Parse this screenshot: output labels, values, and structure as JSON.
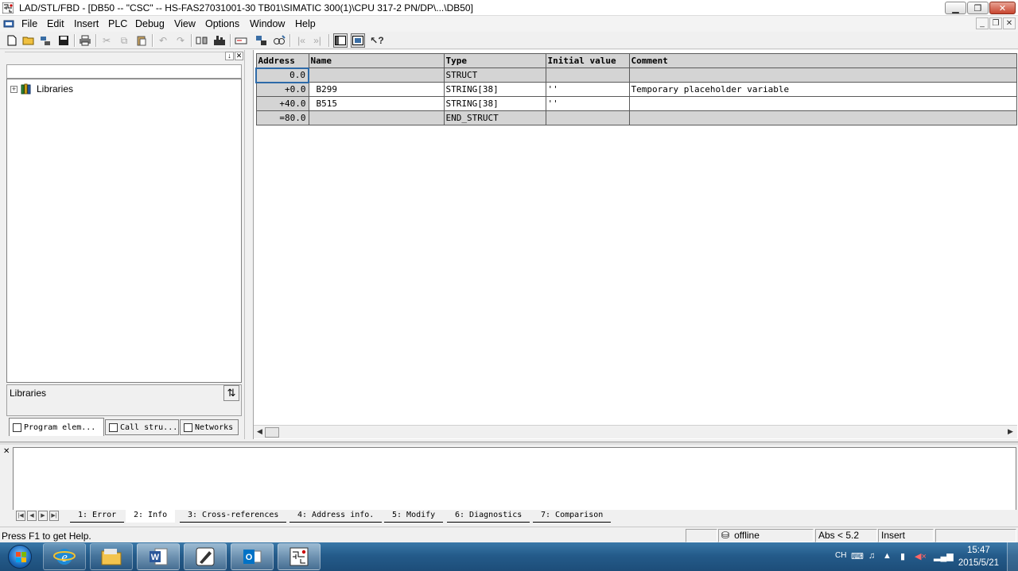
{
  "window": {
    "title": "LAD/STL/FBD  - [DB50 -- \"CSC\" -- HS-FAS27031001-30 TB01\\SIMATIC 300(1)\\CPU 317-2 PN/DP\\...\\DB50]",
    "icon": "lad-stl-fbd-app-icon"
  },
  "menu": {
    "items": [
      "File",
      "Edit",
      "Insert",
      "PLC",
      "Debug",
      "View",
      "Options",
      "Window",
      "Help"
    ]
  },
  "left_panel": {
    "tree_root": "Libraries",
    "description_label": "Libraries",
    "tabs": [
      "Program elem...",
      "Call stru...",
      "Networks"
    ]
  },
  "declaration_table": {
    "headers": [
      "Address",
      "Name",
      "Type",
      "Initial value",
      "Comment"
    ],
    "rows": [
      {
        "address": "0.0",
        "name": "",
        "type": "STRUCT",
        "initial": "",
        "comment": ""
      },
      {
        "address": "+0.0",
        "name": "B299",
        "type": "STRING[38]",
        "initial": "''",
        "comment": "Temporary placeholder variable"
      },
      {
        "address": "+40.0",
        "name": "B515",
        "type": "STRING[38]",
        "initial": "''",
        "comment": ""
      },
      {
        "address": "=80.0",
        "name": "",
        "type": "END_STRUCT",
        "initial": "",
        "comment": ""
      }
    ]
  },
  "output_tabs": [
    "1: Error",
    "2: Info",
    "3: Cross-references",
    "4: Address info.",
    "5: Modify",
    "6: Diagnostics",
    "7: Comparison"
  ],
  "status": {
    "help": "Press F1 to get Help.",
    "mode": "offline",
    "abs": "Abs < 5.2",
    "insert": "Insert"
  },
  "taskbar": {
    "apps": [
      "internet-explorer",
      "file-explorer",
      "word",
      "pen-app",
      "outlook",
      "simatic-lad"
    ],
    "lang": "CH",
    "time": "15:47",
    "date": "2015/5/21"
  },
  "colors": {
    "grid_gray": "#d4d4d4",
    "taskbar_blue": "#245b8a",
    "focus_blue": "#2d6aa8"
  }
}
